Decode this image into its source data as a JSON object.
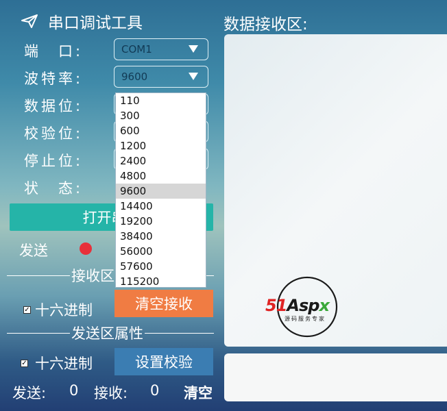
{
  "app": {
    "title": "串口调试工具"
  },
  "settings": {
    "port_label": "端　口:",
    "port_value": "COM1",
    "baud_label": "波特率:",
    "baud_value": "9600",
    "databits_label": "数据位:",
    "parity_label": "校验位:",
    "stopbits_label": "停止位:",
    "status_label": "状　态:"
  },
  "baud_options": [
    "110",
    "300",
    "600",
    "1200",
    "2400",
    "4800",
    "9600",
    "14400",
    "19200",
    "38400",
    "56000",
    "57600",
    "115200"
  ],
  "baud_selected_index": 6,
  "buttons": {
    "open_port": "打开串口",
    "clear_receive": "清空接收",
    "set_checksum": "设置校验",
    "clear": "清空"
  },
  "send_indicator": {
    "label": "发送",
    "color": "#e8303a"
  },
  "receive_section": {
    "title": "接收区属性",
    "hex_label": "十六进制"
  },
  "send_section": {
    "title": "发送区属性",
    "hex_label": "十六进制"
  },
  "counters": {
    "send_label": "发送:",
    "send_value": "0",
    "receive_label": "接收:",
    "receive_value": "0"
  },
  "receive_area": {
    "title": "数据接收区:"
  },
  "watermark": {
    "brand": "51Aspx",
    "tagline": "源码服务专家"
  },
  "colors": {
    "open_button": "#25b4a8",
    "clear_receive_button": "#f07c43",
    "set_checksum_button": "#3b7db2"
  }
}
